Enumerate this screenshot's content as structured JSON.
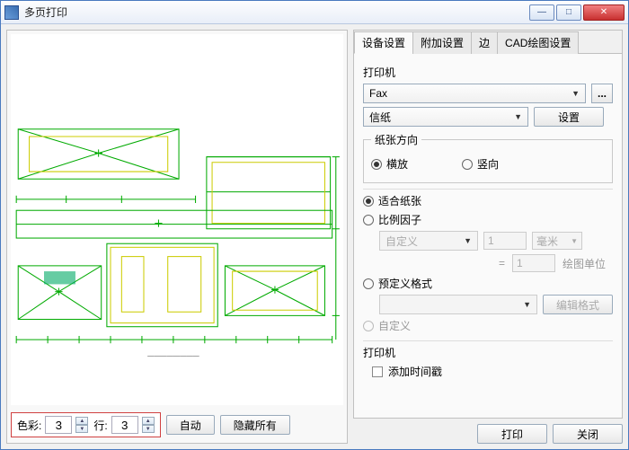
{
  "window": {
    "title": "多页打印"
  },
  "winbtns": {
    "min": "—",
    "max": "□",
    "close": "✕"
  },
  "left": {
    "color_label": "色彩:",
    "color_value": "3",
    "row_label": "行:",
    "row_value": "3",
    "auto_btn": "自动",
    "hide_all_btn": "隐藏所有"
  },
  "tabs": {
    "t1": "设备设置",
    "t2": "附加设置",
    "t3": "边",
    "t4": "CAD绘图设置"
  },
  "panel": {
    "printer_label": "打印机",
    "printer_value": "Fax",
    "more_btn": "...",
    "paper_value": "信纸",
    "settings_btn": "设置",
    "orient_group": "纸张方向",
    "orient_h": "横放",
    "orient_v": "竖向",
    "fit_paper": "适合纸张",
    "scale_factor": "比例因子",
    "scale_combo": "自定义",
    "scale_num1": "1",
    "scale_unit": "毫米",
    "scale_eq": "=",
    "scale_num2": "1",
    "scale_unit2": "绘图单位",
    "predef_format": "预定义格式",
    "edit_format_btn": "编辑格式",
    "custom_radio": "自定义",
    "printer_group2": "打印机",
    "add_timestamp": "添加时间戳"
  },
  "footer": {
    "print": "打印",
    "close": "关闭"
  }
}
